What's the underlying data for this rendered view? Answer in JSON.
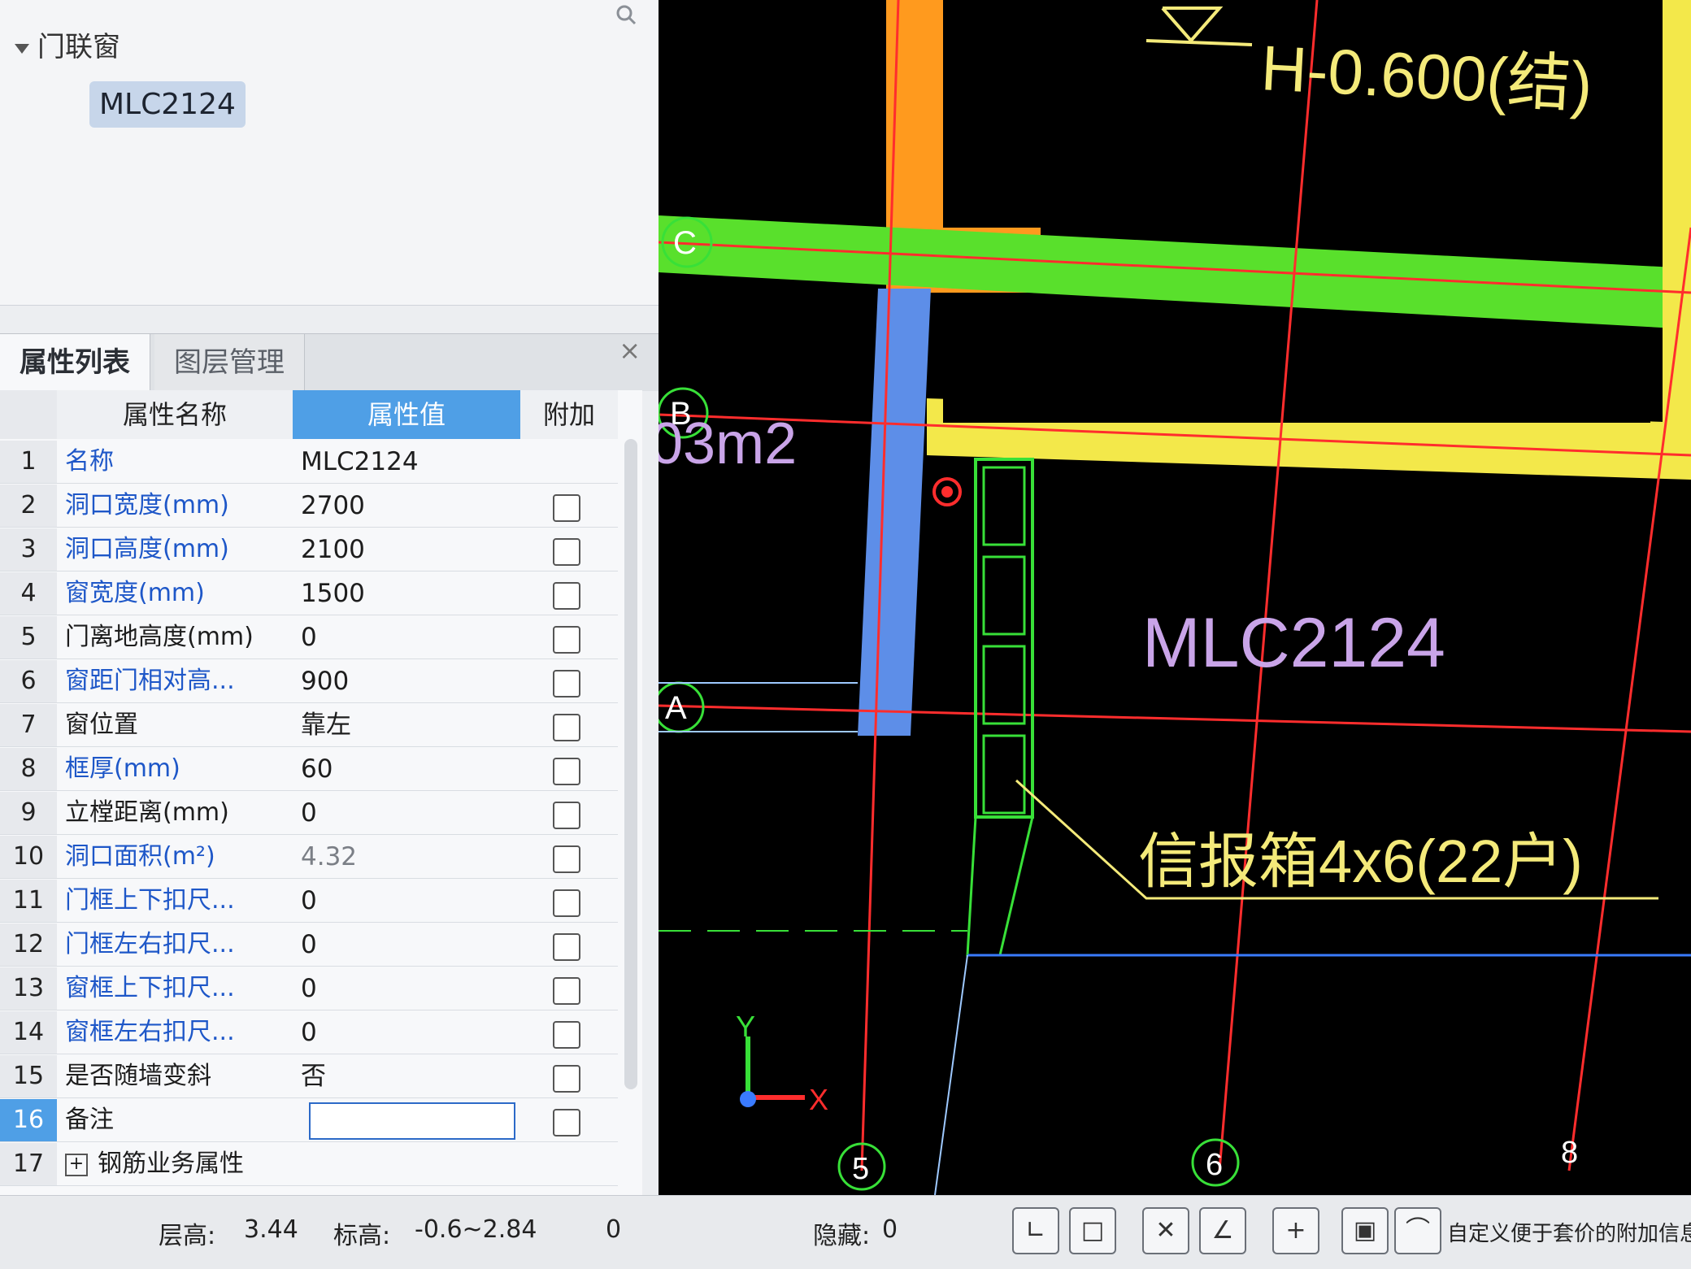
{
  "tree": {
    "group_label": "门联窗",
    "selected_item": "MLC2124"
  },
  "panel_tabs": {
    "active": "属性列表",
    "inactive": "图层管理"
  },
  "grid": {
    "headers": {
      "name": "属性名称",
      "value": "属性值",
      "extra": "附加"
    },
    "rows": [
      {
        "num": "1",
        "name": "名称",
        "value": "MLC2124"
      },
      {
        "num": "2",
        "name": "洞口宽度(mm)",
        "value": "2700"
      },
      {
        "num": "3",
        "name": "洞口高度(mm)",
        "value": "2100"
      },
      {
        "num": "4",
        "name": "窗宽度(mm)",
        "value": "1500"
      },
      {
        "num": "5",
        "name": "门离地高度(mm)",
        "value": "0"
      },
      {
        "num": "6",
        "name": "窗距门相对高...",
        "value": "900"
      },
      {
        "num": "7",
        "name": "窗位置",
        "value": "靠左"
      },
      {
        "num": "8",
        "name": "框厚(mm)",
        "value": "60"
      },
      {
        "num": "9",
        "name": "立樘距离(mm)",
        "value": "0"
      },
      {
        "num": "10",
        "name": "洞口面积(m²)",
        "value": "4.32"
      },
      {
        "num": "11",
        "name": "门框上下扣尺...",
        "value": "0"
      },
      {
        "num": "12",
        "name": "门框左右扣尺...",
        "value": "0"
      },
      {
        "num": "13",
        "name": "窗框上下扣尺...",
        "value": "0"
      },
      {
        "num": "14",
        "name": "窗框左右扣尺...",
        "value": "0"
      },
      {
        "num": "15",
        "name": "是否随墙变斜",
        "value": "否"
      },
      {
        "num": "16",
        "name": "备注",
        "value": ""
      },
      {
        "num": "17",
        "name": "钢筋业务属性",
        "value": ""
      }
    ]
  },
  "cad": {
    "elevation_text": "H-0.600(结)",
    "element_label": "MLC2124",
    "box_label": "信报箱4x6(22户)",
    "partial_text": "03m2",
    "axes": {
      "row_labels": [
        "C",
        "B",
        "A"
      ],
      "col_labels": [
        "5",
        "6",
        "8"
      ]
    },
    "ucs": {
      "x": "X",
      "y": "Y"
    },
    "colors": {
      "wall_orange": "#ff9a1e",
      "wall_green": "#59e02c",
      "wall_yellow": "#f3e84a",
      "wall_blue": "#5d8ee8",
      "axis_red": "#ff2d2d",
      "text_yellow": "#f4ea7a",
      "text_violet": "#c9a4e8",
      "frame_green": "#38e038"
    }
  },
  "status": {
    "floor_height_label": "层高:",
    "floor_height_value": "3.44",
    "elevation_label": "标高:",
    "elevation_value": "-0.6~2.84",
    "count_value": "0",
    "hidden_label": "隐藏:",
    "hidden_value": "0",
    "hint": "自定义便于套价的附加信息"
  }
}
